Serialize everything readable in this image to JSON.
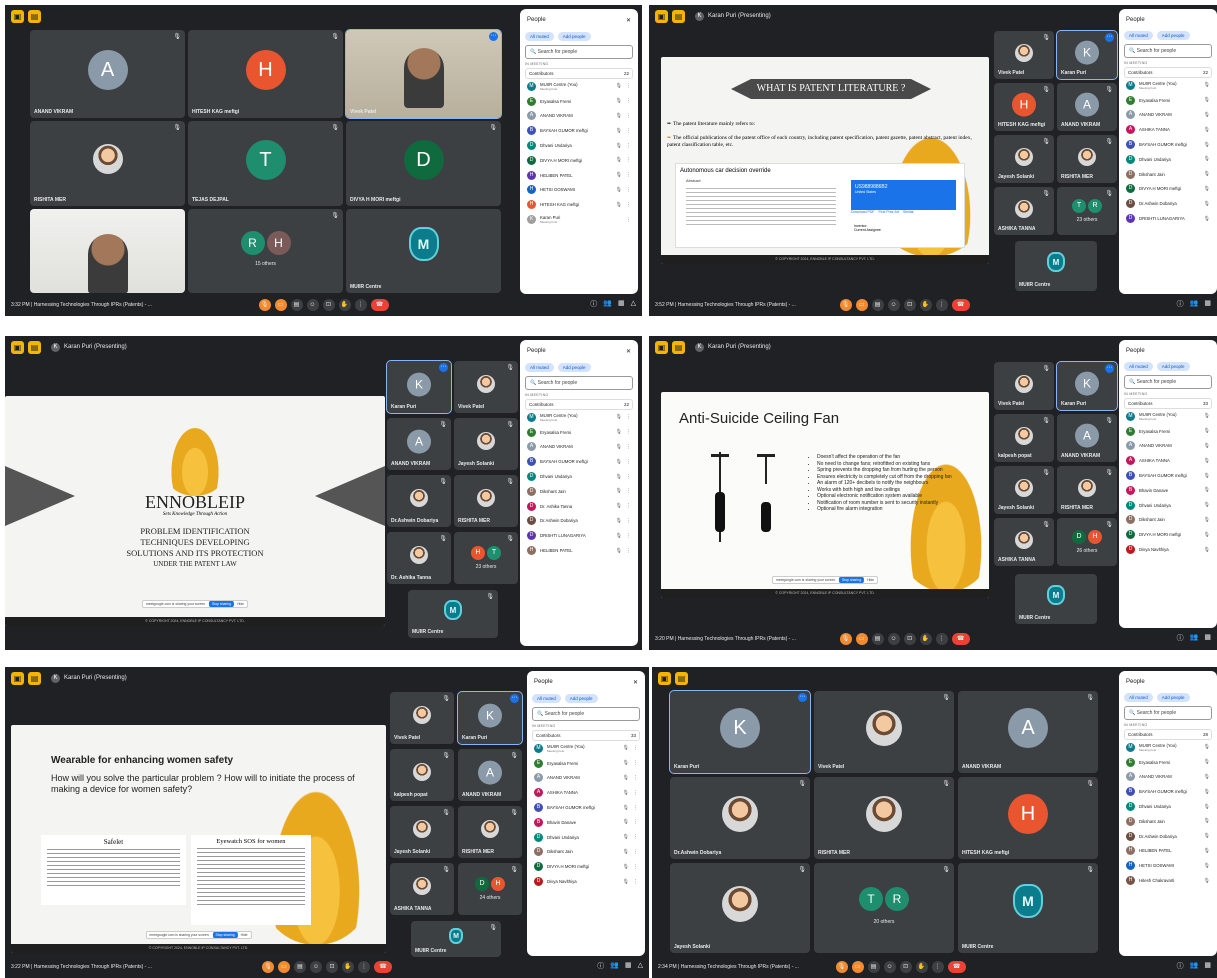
{
  "colors": {
    "accent": "#1a73e8",
    "end": "#ea4335",
    "dark": "#202124",
    "tile": "#3c4043"
  },
  "icons": {
    "mic_off": "🎙",
    "more": "⋮",
    "close": "✕",
    "search": "🔍",
    "chevron_up": "^"
  },
  "shots": [
    {
      "time_title": "3:32 PM | Harnessing Technologies Through IPRs (Patents) - ...",
      "tiles": [
        {
          "name": "ANAND VIKRAM",
          "letter": "A"
        },
        {
          "name": "HITESH KAG meftgi",
          "letter": "H"
        },
        {
          "name": "Vivek Patel"
        },
        {
          "name": "RISHITA MER"
        },
        {
          "name": "TEJAS DEJPAL",
          "letter": "T"
        },
        {
          "name": "DIVYA H MORI meftgi",
          "letter": "D"
        },
        {
          "name": "",
          "letters": [
            "R",
            "H"
          ],
          "others": "15 others"
        },
        {
          "name": "MUIIR Centre"
        }
      ],
      "people": {
        "title": "People",
        "muted": "All muted",
        "add": "Add people",
        "search": "Search for people",
        "in_meeting": "IN MEETING",
        "contributors": "Contributors",
        "count": "22",
        "list": [
          "MUIIR Centre (You)",
          "Eryasalsa Fremi",
          "ANAND VIKRAM",
          "BAYSAH GUMOR meftgi",
          "Dhvani Undariya",
          "DIVYA H MORI meftgi",
          "HELIBEN PATEL",
          "HETSI GOSWAMI",
          "HITESH KAG meftgi",
          "Karan Puri"
        ],
        "sub": "Meeting host",
        "sub_last": "Meeting host"
      }
    },
    {
      "presenter": "Karan Puri (Presenting)",
      "time_title": "3:52 PM | Harnessing Technologies Through IPRs (Patents) - ...",
      "slide": {
        "title": "WHAT IS PATENT LITERATURE ?",
        "b1": "The patent literature mainly refers to:",
        "b2": "The official publications of the patent office of each country, including patent specification, patent gazette, patent abstract, patent index, patent classification table, etc.",
        "card_title": "Autonomous car decision override",
        "card_abstract": "Abstract",
        "card_id": "US9889886B2",
        "card_status": "United States",
        "card_btn1": "Download PDF",
        "card_btn2": "Find Prior Art",
        "card_btn3": "Similar",
        "card_inv": "Inventor",
        "card_asg": "Current Assignee"
      },
      "tiles": [
        {
          "name": "Vivek Patel"
        },
        {
          "name": "Karan Puri",
          "letter": "K"
        },
        {
          "name": "HITESH KAG meftgi",
          "letter": "H"
        },
        {
          "name": "ANAND VIKRAM",
          "letter": "A"
        },
        {
          "name": "Jayesh Solanki"
        },
        {
          "name": "RISHITA MER"
        },
        {
          "name": "ASHIKA TANNA"
        },
        {
          "name": "",
          "letters": [
            "T",
            "R"
          ],
          "others": "23 others"
        },
        {
          "name": "MUIIR Centre"
        }
      ],
      "people": {
        "title": "People",
        "muted": "All muted",
        "add": "Add people",
        "search": "Search for people",
        "in_meeting": "IN MEETING",
        "contributors": "Contributors",
        "count": "22",
        "list": [
          "MUIIR Centre (You)",
          "Eryasalsa Fremi",
          "ANAND VIKRAM",
          "ASHIKA TANNA",
          "BAYSAH GUMOR meftgi",
          "Dhvani Undariya",
          "Dikshant Jain",
          "DIVYA H MORI meftgi",
          "Dr.Ashwin Dobariya",
          "DRISHTI LUNAGARIYA"
        ],
        "sub": "Meeting host"
      }
    },
    {
      "presenter": "Karan Puri (Presenting)",
      "time_title": "",
      "slide": {
        "brand": "ENNOBLEIP",
        "tag": "Sets Knowledge Through Action",
        "l1": "PROBLEM IDENTIFICATION",
        "l2": "TECHNIQUES DEVELOPING",
        "l3": "SOLUTIONS AND ITS PROTECTION",
        "l4": "UNDER THE PATENT LAW"
      },
      "tiles": [
        {
          "name": "Karan Puri",
          "letter": "K"
        },
        {
          "name": "Vivek Patel"
        },
        {
          "name": "ANAND VIKRAM",
          "letter": "A"
        },
        {
          "name": "Jayesh Solanki"
        },
        {
          "name": "Dr.Ashwin Dobariya"
        },
        {
          "name": "RISHITA MER"
        },
        {
          "name": "Dr. Ashika Tanna"
        },
        {
          "name": "",
          "letters": [
            "H",
            "T"
          ],
          "others": "23 others"
        },
        {
          "name": "MUIIR Centre"
        }
      ],
      "people": {
        "title": "People",
        "muted": "All muted",
        "add": "Add people",
        "search": "Search for people",
        "in_meeting": "IN MEETING",
        "contributors": "Contributors",
        "count": "22",
        "list": [
          "MUIIR Centre (You)",
          "Eryasalsa Fremi",
          "ANAND VIKRAM",
          "BAYSAH GUMOR meftgi",
          "Dhvani Undariya",
          "Dikshant Jain",
          "Dr. Ashika Tanna",
          "Dr.Ashwin Dobariya",
          "DRISHTI LUNAGARIYA",
          "HELIBEN PATEL"
        ],
        "sub": "Meeting host"
      }
    },
    {
      "presenter": "Karan Puri (Presenting)",
      "time_title": "3:20 PM | Harnessing Technologies Through IPRs (Patents) - ...",
      "slide": {
        "title": "Anti-Suicide Ceiling Fan",
        "bullets": [
          "Doesn't affect the operation of the fan",
          "No need to change fans; retrofitted on existing fans",
          "Spring prevents the dropping fan from hurting the person",
          "Ensures electricity is completely cut off from the dropping fan",
          "An alarm of 120+ decibels to notify the neighbours",
          "Works with both high and low ceilings",
          "Optional electronic notification system available",
          "Notification of room number is sent to security instantly",
          "Optional fire alarm integration"
        ]
      },
      "tiles": [
        {
          "name": "Vivek Patel"
        },
        {
          "name": "Karan Puri",
          "letter": "K"
        },
        {
          "name": "kalpesh popat"
        },
        {
          "name": "ANAND VIKRAM",
          "letter": "A"
        },
        {
          "name": "Jayesh Solanki"
        },
        {
          "name": "RISHITA MER"
        },
        {
          "name": "ASHIKA TANNA"
        },
        {
          "name": "",
          "letters": [
            "D",
            "H"
          ],
          "others": "26 others"
        },
        {
          "name": "MUIIR Centre"
        }
      ],
      "people": {
        "title": "People",
        "muted": "All muted",
        "add": "Add people",
        "search": "Search for people",
        "in_meeting": "IN MEETING",
        "contributors": "Contributors",
        "count": "33",
        "list": [
          "MUIIR Centre (You)",
          "Eryasalsa Fremi",
          "ANAND VIKRAM",
          "ASHIKA TANNA",
          "BAYSAH GUMOR meftgi",
          "Bhavin Danave",
          "Dhvani Undariya",
          "Dikshant Jain",
          "DIVYA H MORI meftgi",
          "Divya Navlthiya"
        ],
        "sub": "Meeting host"
      }
    },
    {
      "presenter": "Karan Puri (Presenting)",
      "time_title": "3:22 PM | Harnessing Technologies Through IPRs (Patents) - ...",
      "slide": {
        "title": "Wearable for enhancing women safety",
        "q": "How will you solve the particular problem ? How will to initiate the process of making a device for women safety?",
        "c1": "Safelet",
        "c2": "Eyewatch SOS for women"
      },
      "tiles": [
        {
          "name": "Vivek Patel"
        },
        {
          "name": "Karan Puri",
          "letter": "K"
        },
        {
          "name": "kalpesh popat"
        },
        {
          "name": "ANAND VIKRAM",
          "letter": "A"
        },
        {
          "name": "Jayesh Solanki"
        },
        {
          "name": "RISHITA MER"
        },
        {
          "name": "ASHIKA TANNA"
        },
        {
          "name": "",
          "letters": [
            "D",
            "H"
          ],
          "others": "24 others"
        },
        {
          "name": "MUIIR Centre"
        }
      ],
      "people": {
        "title": "People",
        "muted": "All muted",
        "add": "Add people",
        "search": "Search for people",
        "in_meeting": "IN MEETING",
        "contributors": "Contributors",
        "count": "33",
        "list": [
          "MUIIR Centre (You)",
          "Eryasalsa Fremi",
          "ANAND VIKRAM",
          "ASHIKA TANNA",
          "BAYSAH GUMOR meftgi",
          "Bhavin Danave",
          "Dhvani Undariya",
          "Dikshant Jain",
          "DIVYA H MORI meftgi",
          "Divya Navlthiya"
        ],
        "sub": "Meeting host"
      }
    },
    {
      "time_title": "2:34 PM | Harnessing Technologies Through IPRs (Patents) - ...",
      "tiles": [
        {
          "name": "Karan Puri",
          "letter": "K"
        },
        {
          "name": "Vivek Patel"
        },
        {
          "name": "ANAND VIKRAM",
          "letter": "A"
        },
        {
          "name": "Dr.Ashwin Dobariya"
        },
        {
          "name": "RISHITA MER"
        },
        {
          "name": "HITESH KAG meftgi",
          "letter": "H"
        },
        {
          "name": "Jayesh Solanki"
        },
        {
          "name": "",
          "letters": [
            "T",
            "R"
          ],
          "others": "20 others"
        },
        {
          "name": "MUIIR Centre"
        }
      ],
      "people": {
        "title": "People",
        "muted": "All muted",
        "add": "Add people",
        "search": "Search for people",
        "in_meeting": "IN MEETING",
        "contributors": "Contributors",
        "count": "28",
        "list": [
          "MUIIR Centre (You)",
          "Eryasalsa Fremi",
          "ANAND VIKRAM",
          "BAYSAH GUMOR meftgi",
          "Dhvani Undariya",
          "Dikshant Jain",
          "Dr.Ashwin Dobariya",
          "HELIBEN PATEL",
          "HETSI GOSWAMI",
          "Hitesh Chakravarti"
        ],
        "sub": "Meeting host"
      }
    }
  ]
}
